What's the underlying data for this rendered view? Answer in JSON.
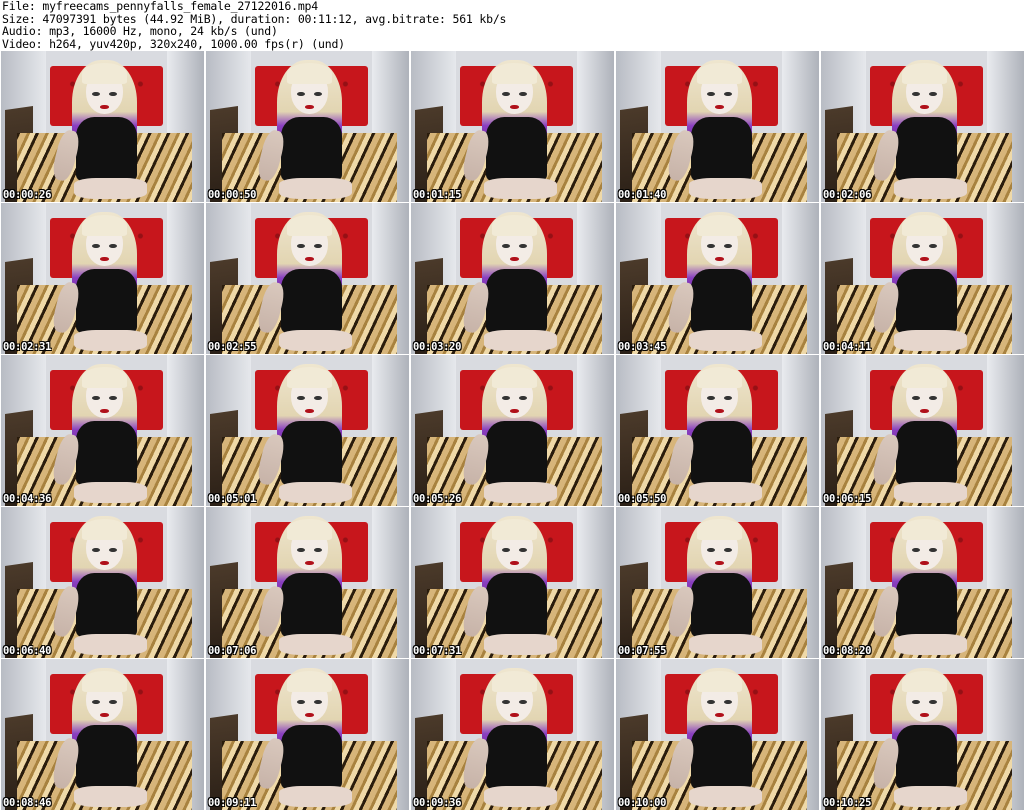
{
  "header": {
    "file": "File: myfreecams_pennyfalls_female_27122016.mp4",
    "size": "Size: 47097391 bytes (44.92 MiB), duration: 00:11:12, avg.bitrate: 561 kb/s",
    "audio": "Audio: mp3, 16000 Hz, mono, 24 kb/s (und)",
    "video": "Video: h264, yuv420p, 320x240, 1000.00 fps(r) (und)"
  },
  "thumbnails": [
    {
      "time": "00:00:26"
    },
    {
      "time": "00:00:50"
    },
    {
      "time": "00:01:15"
    },
    {
      "time": "00:01:40"
    },
    {
      "time": "00:02:06"
    },
    {
      "time": "00:02:31"
    },
    {
      "time": "00:02:55"
    },
    {
      "time": "00:03:20"
    },
    {
      "time": "00:03:45"
    },
    {
      "time": "00:04:11"
    },
    {
      "time": "00:04:36"
    },
    {
      "time": "00:05:01"
    },
    {
      "time": "00:05:26"
    },
    {
      "time": "00:05:50"
    },
    {
      "time": "00:06:15"
    },
    {
      "time": "00:06:40"
    },
    {
      "time": "00:07:06"
    },
    {
      "time": "00:07:31"
    },
    {
      "time": "00:07:55"
    },
    {
      "time": "00:08:20"
    },
    {
      "time": "00:08:46"
    },
    {
      "time": "00:09:11"
    },
    {
      "time": "00:09:36"
    },
    {
      "time": "00:10:00"
    },
    {
      "time": "00:10:25"
    }
  ]
}
